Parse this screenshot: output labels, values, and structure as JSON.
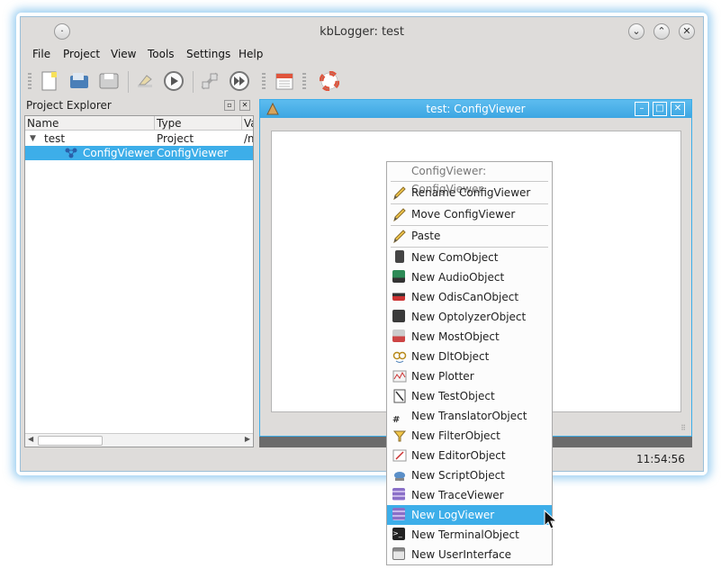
{
  "window": {
    "title": "kbLogger: test"
  },
  "menubar": [
    "File",
    "Project",
    "View",
    "Tools",
    "Settings",
    "Help"
  ],
  "toolbar": {
    "icons": [
      "new-icon",
      "open-icon",
      "save-icon",
      "eraser-icon",
      "play-icon",
      "connect-icon",
      "fast-forward-icon",
      "calendar-icon",
      "lifebuoy-icon"
    ]
  },
  "project_explorer": {
    "title": "Project Explorer",
    "columns": [
      "Name",
      "Type",
      "Va"
    ],
    "rows": [
      {
        "name": "test",
        "type": "Project",
        "value": "/m"
      },
      {
        "name": "ConfigViewer",
        "type": "ConfigViewer",
        "value": ""
      }
    ]
  },
  "subwindow": {
    "title": "test: ConfigViewer"
  },
  "context_menu": {
    "header": "ConfigViewer: ConfigViewer",
    "groups": [
      [
        {
          "label": "Rename ConfigViewer",
          "icon": "pencil-icon"
        }
      ],
      [
        {
          "label": "Move ConfigViewer",
          "icon": "pencil-icon"
        }
      ],
      [
        {
          "label": "Paste",
          "icon": "pencil-icon"
        }
      ],
      [
        {
          "label": "New ComObject",
          "icon": "com-object-icon"
        },
        {
          "label": "New AudioObject",
          "icon": "audio-object-icon"
        },
        {
          "label": "New OdisCanObject",
          "icon": "odis-can-object-icon"
        },
        {
          "label": "New OptolyzerObject",
          "icon": "optolyzer-object-icon"
        },
        {
          "label": "New MostObject",
          "icon": "most-object-icon"
        },
        {
          "label": "New DltObject",
          "icon": "dlt-object-icon"
        },
        {
          "label": "New Plotter",
          "icon": "plotter-icon"
        },
        {
          "label": "New TestObject",
          "icon": "test-object-icon"
        },
        {
          "label": "New TranslatorObject",
          "icon": "translator-object-icon"
        },
        {
          "label": "New FilterObject",
          "icon": "filter-object-icon"
        },
        {
          "label": "New EditorObject",
          "icon": "editor-object-icon"
        },
        {
          "label": "New ScriptObject",
          "icon": "script-object-icon"
        },
        {
          "label": "New TraceViewer",
          "icon": "trace-viewer-icon"
        },
        {
          "label": "New LogViewer",
          "icon": "log-viewer-icon"
        },
        {
          "label": "New TerminalObject",
          "icon": "terminal-object-icon"
        },
        {
          "label": "New UserInterface",
          "icon": "user-interface-icon"
        }
      ]
    ],
    "highlighted": "New LogViewer"
  },
  "statusbar": {
    "time": "11:54:56"
  }
}
